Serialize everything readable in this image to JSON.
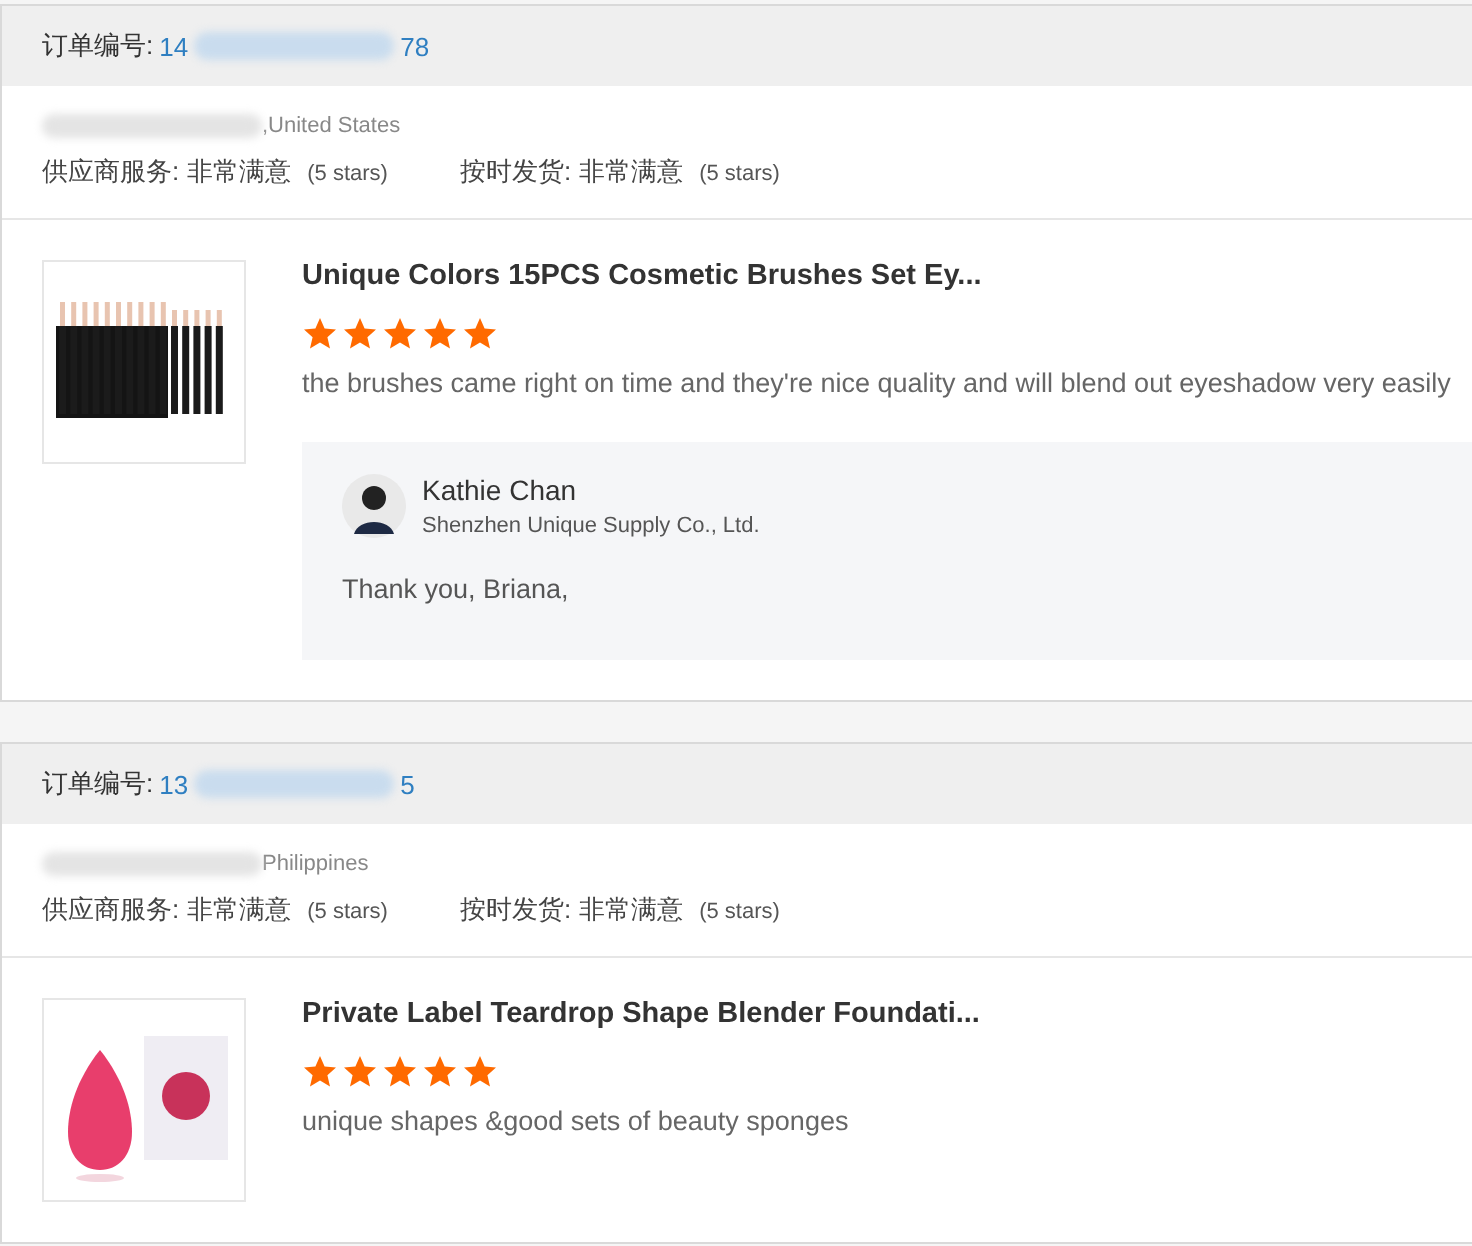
{
  "orders": [
    {
      "order_label": "订单编号:",
      "order_number_start": "14",
      "order_number_end": "78",
      "location": ",United States",
      "ratings": [
        {
          "label": "供应商服务:",
          "value": "非常满意",
          "stars_text": "(5 stars)"
        },
        {
          "label": "按时发货:",
          "value": "非常满意",
          "stars_text": "(5 stars)"
        }
      ],
      "product": {
        "kind": "brushes",
        "title": "Unique Colors 15PCS Cosmetic Brushes Set Ey...",
        "stars": 5,
        "review": "the brushes came right on time and they're nice quality and will blend out eyeshadow very easily",
        "reply": {
          "name": "Kathie Chan",
          "company": "Shenzhen Unique Supply Co., Ltd.",
          "text": "Thank you, Briana,"
        }
      }
    },
    {
      "order_label": "订单编号:",
      "order_number_start": "13",
      "order_number_end": "5",
      "location": "Philippines",
      "ratings": [
        {
          "label": "供应商服务:",
          "value": "非常满意",
          "stars_text": "(5 stars)"
        },
        {
          "label": "按时发货:",
          "value": "非常满意",
          "stars_text": "(5 stars)"
        }
      ],
      "product": {
        "kind": "sponge",
        "title": "Private Label Teardrop Shape Blender Foundati...",
        "stars": 5,
        "review": "unique shapes &good sets of beauty sponges"
      }
    }
  ]
}
